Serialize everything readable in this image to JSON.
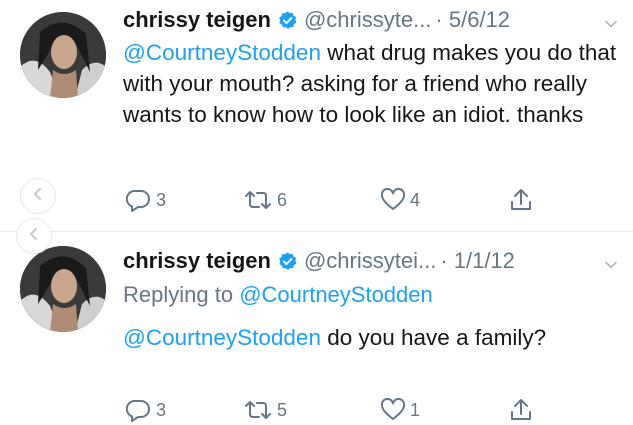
{
  "tweets": [
    {
      "display_name": "chrissy teigen",
      "handle": "@chrissyte...",
      "date": "· 5/6/12",
      "body_mention": "@CourtneyStodden",
      "body_text": " what drug makes you do that with your mouth? asking for a friend who really wants to know how to look like an idiot. thanks",
      "reply_count": "3",
      "retweet_count": "6",
      "like_count": "4"
    },
    {
      "display_name": "chrissy teigen",
      "handle": "@chrissytei...",
      "date": "· 1/1/12",
      "replying_prefix": "Replying to ",
      "replying_mention": "@CourtneyStodden",
      "body_mention": "@CourtneyStodden",
      "body_text": " do you have a family?",
      "reply_count": "3",
      "retweet_count": "5",
      "like_count": "1"
    }
  ],
  "colors": {
    "link": "#1da1f2",
    "muted": "#657786",
    "verified": "#1da1f2",
    "text": "#14171a"
  },
  "icons": [
    "verified-badge-icon",
    "chevron-down-icon",
    "reply-icon",
    "retweet-icon",
    "heart-icon",
    "share-icon",
    "chevron-left-icon"
  ]
}
